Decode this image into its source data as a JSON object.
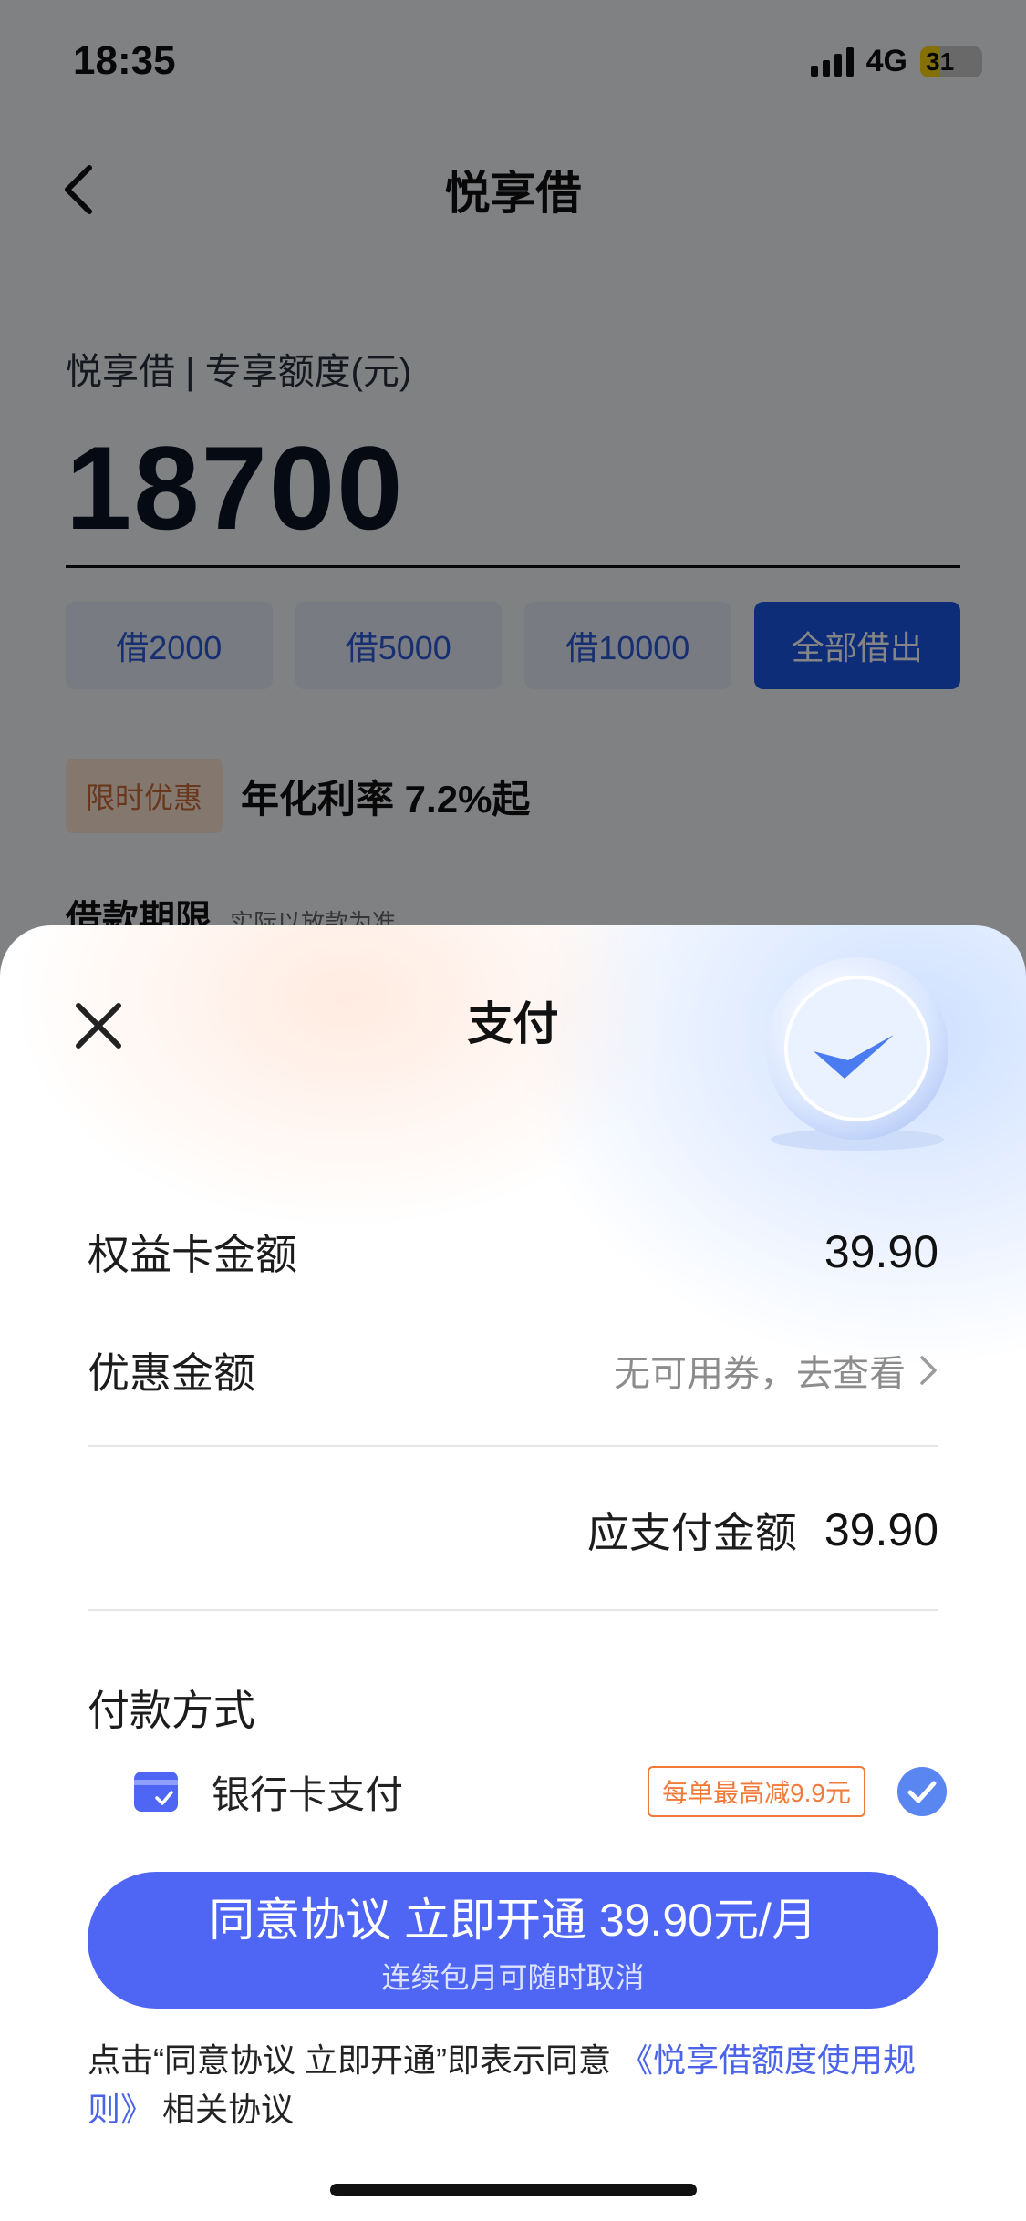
{
  "status_bar": {
    "time": "18:35",
    "network": "4G",
    "battery": "31"
  },
  "nav": {
    "title": "悦享借"
  },
  "loan": {
    "limit_label": "悦享借 | 专享额度(元)",
    "amount": "18700",
    "quick_amounts": [
      "借2000",
      "借5000",
      "借10000",
      "全部借出"
    ],
    "promo_tag": "限时优惠",
    "promo_text": "年化利率 7.2%起",
    "term_title": "借款期限",
    "term_sub": "实际以放款为准"
  },
  "sheet": {
    "title": "支付",
    "benefit_label": "权益卡金额",
    "benefit_value": "39.90",
    "discount_label": "优惠金额",
    "discount_link": "无可用券，去查看",
    "total_label": "应支付金额",
    "total_value": "39.90",
    "pay_method_title": "付款方式",
    "pay_option_label": "银行卡支付",
    "pay_option_discount": "每单最高减9.9元",
    "cta_main": "同意协议 立即开通 39.90元/月",
    "cta_sub": "连续包月可随时取消",
    "agree_prefix": "点击“同意协议 立即开通”即表示同意 ",
    "agree_link": "《悦享借额度使用规则》",
    "agree_suffix": " 相关协议"
  },
  "colors": {
    "accent": "#4f66f4",
    "primary_blue": "#1a56e8",
    "promo": "#f07a3a",
    "link": "#4a63e8"
  }
}
